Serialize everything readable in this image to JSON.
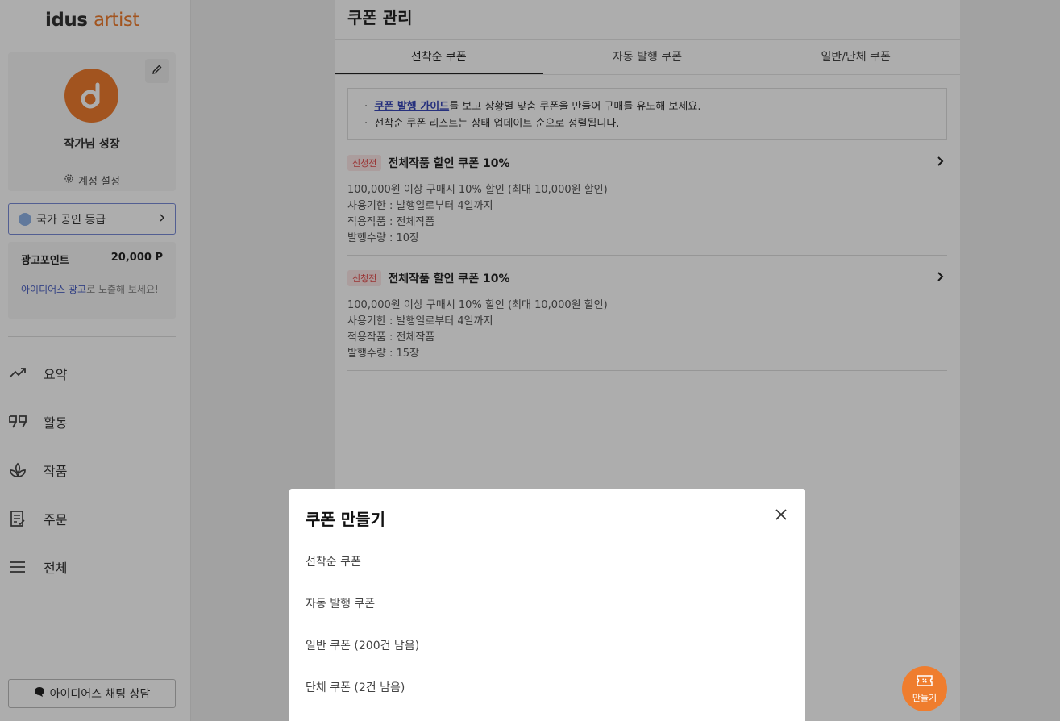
{
  "logo": {
    "id_text": "idus",
    "artist_text": "artist"
  },
  "sidebar": {
    "profile_name": "작가님 성장",
    "account_settings": "계정 설정",
    "grade_button": "국가 공인 등급",
    "ad_points_label": "광고포인트",
    "ad_points_value": "20,000 P",
    "ad_link": "아이디어스 광고",
    "ad_desc_suffix": "로 노출해 보세요!",
    "nav": [
      {
        "label": "요약",
        "icon": "trending-up-icon"
      },
      {
        "label": "활동",
        "icon": "quote-icon"
      },
      {
        "label": "작품",
        "icon": "plant-icon"
      },
      {
        "label": "주문",
        "icon": "order-list-icon"
      },
      {
        "label": "전체",
        "icon": "menu-icon"
      }
    ],
    "chat_button": "아이디어스 채팅 상담"
  },
  "main": {
    "title": "쿠폰 관리",
    "tabs": [
      "선착순 쿠폰",
      "자동 발행 쿠폰",
      "일반/단체 쿠폰"
    ],
    "active_tab": 0,
    "notice": {
      "link": "쿠폰 발행 가이드",
      "line1_suffix": "를 보고 상황별 맞춤 쿠폰을 만들어 구매를 유도해 보세요.",
      "line2": "선착순 쿠폰 리스트는 상태 업데이트 순으로 정렬됩니다."
    },
    "coupons": [
      {
        "badge": "신청전",
        "title": "전체작품 할인 쿠폰 10%",
        "lines": [
          "100,000원 이상 구매시 10% 할인 (최대 10,000원 할인)",
          "사용기한 : 발행일로부터 4일까지",
          "적용작품 : 전체작품",
          "발행수량 : 10장"
        ]
      },
      {
        "badge": "신청전",
        "title": "전체작품 할인 쿠폰 10%",
        "lines": [
          "100,000원 이상 구매시 10% 할인 (최대 10,000원 할인)",
          "사용기한 : 발행일로부터 4일까지",
          "적용작품 : 전체작품",
          "발행수량 : 15장"
        ]
      }
    ]
  },
  "modal": {
    "title": "쿠폰 만들기",
    "options": [
      "선착순 쿠폰",
      "자동 발행 쿠폰",
      "일반 쿠폰 (200건 남음)",
      "단체 쿠폰 (2건 남음)"
    ]
  },
  "fab": {
    "label": "만들기"
  },
  "colors": {
    "brand": "#ef7d2e",
    "link": "#3848b8",
    "badge_bg": "#fde7e7",
    "badge_text": "#e24b4b"
  }
}
